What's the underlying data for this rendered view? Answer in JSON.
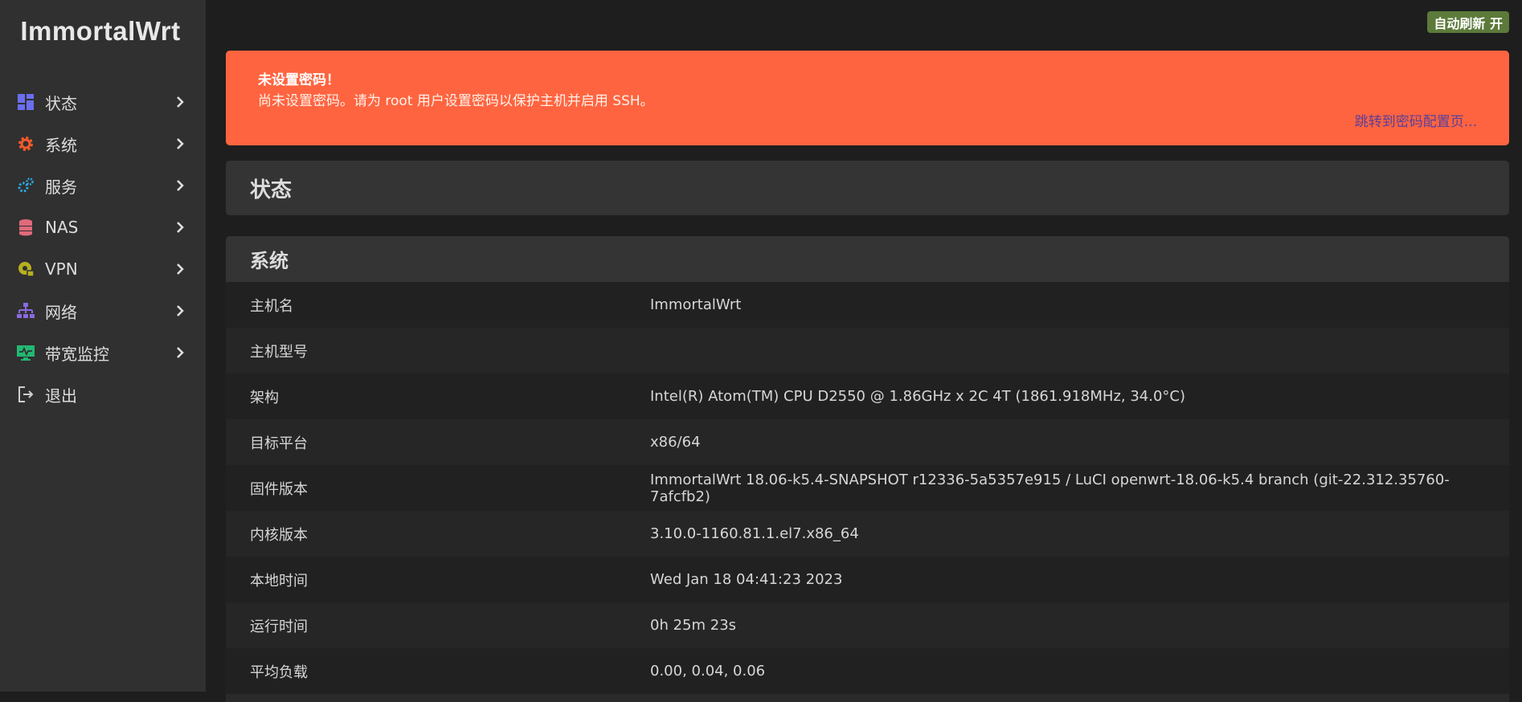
{
  "app": {
    "logo": "ImmortalWrt"
  },
  "sidebar": {
    "items": [
      {
        "label": "状态",
        "icon": "dashboard-icon",
        "color": "#6a6ef0"
      },
      {
        "label": "系统",
        "icon": "gear-icon",
        "color": "#f05a2a"
      },
      {
        "label": "服务",
        "icon": "gears-icon",
        "color": "#2aa7e0"
      },
      {
        "label": "NAS",
        "icon": "database-icon",
        "color": "#e06a7a"
      },
      {
        "label": "VPN",
        "icon": "globe-lock-icon",
        "color": "#b8b020"
      },
      {
        "label": "网络",
        "icon": "network-icon",
        "color": "#8a6ae0"
      },
      {
        "label": "带宽监控",
        "icon": "monitor-icon",
        "color": "#22b872"
      },
      {
        "label": "退出",
        "icon": "logout-icon",
        "color": "#cfcfcf"
      }
    ]
  },
  "header": {
    "refresh_label": "自动刷新 开"
  },
  "alert": {
    "title": "未设置密码！",
    "text": "尚未设置密码。请为 root 用户设置密码以保护主机并启用 SSH。",
    "link": "跳转到密码配置页..."
  },
  "page": {
    "title": "状态"
  },
  "system": {
    "title": "系统",
    "rows": [
      {
        "key": "主机名",
        "value": "ImmortalWrt"
      },
      {
        "key": "主机型号",
        "value": ""
      },
      {
        "key": "架构",
        "value": "Intel(R) Atom(TM) CPU D2550 @ 1.86GHz x 2C 4T (1861.918MHz, 34.0°C)"
      },
      {
        "key": "目标平台",
        "value": "x86/64"
      },
      {
        "key": "固件版本",
        "value": "ImmortalWrt 18.06-k5.4-SNAPSHOT r12336-5a5357e915 / LuCI openwrt-18.06-k5.4 branch (git-22.312.35760-7afcfb2)"
      },
      {
        "key": "内核版本",
        "value": "3.10.0-1160.81.1.el7.x86_64"
      },
      {
        "key": "本地时间",
        "value": "Wed Jan 18 04:41:23 2023"
      },
      {
        "key": "运行时间",
        "value": "0h 25m 23s"
      },
      {
        "key": "平均负载",
        "value": "0.00, 0.04, 0.06"
      }
    ]
  },
  "colors": {
    "sidebar_bg": "#303030",
    "main_bg": "#1e1e1e",
    "alert_bg": "#ff6440",
    "alert_link": "#5a3f9a",
    "badge_bg": "#5c7a3a"
  }
}
